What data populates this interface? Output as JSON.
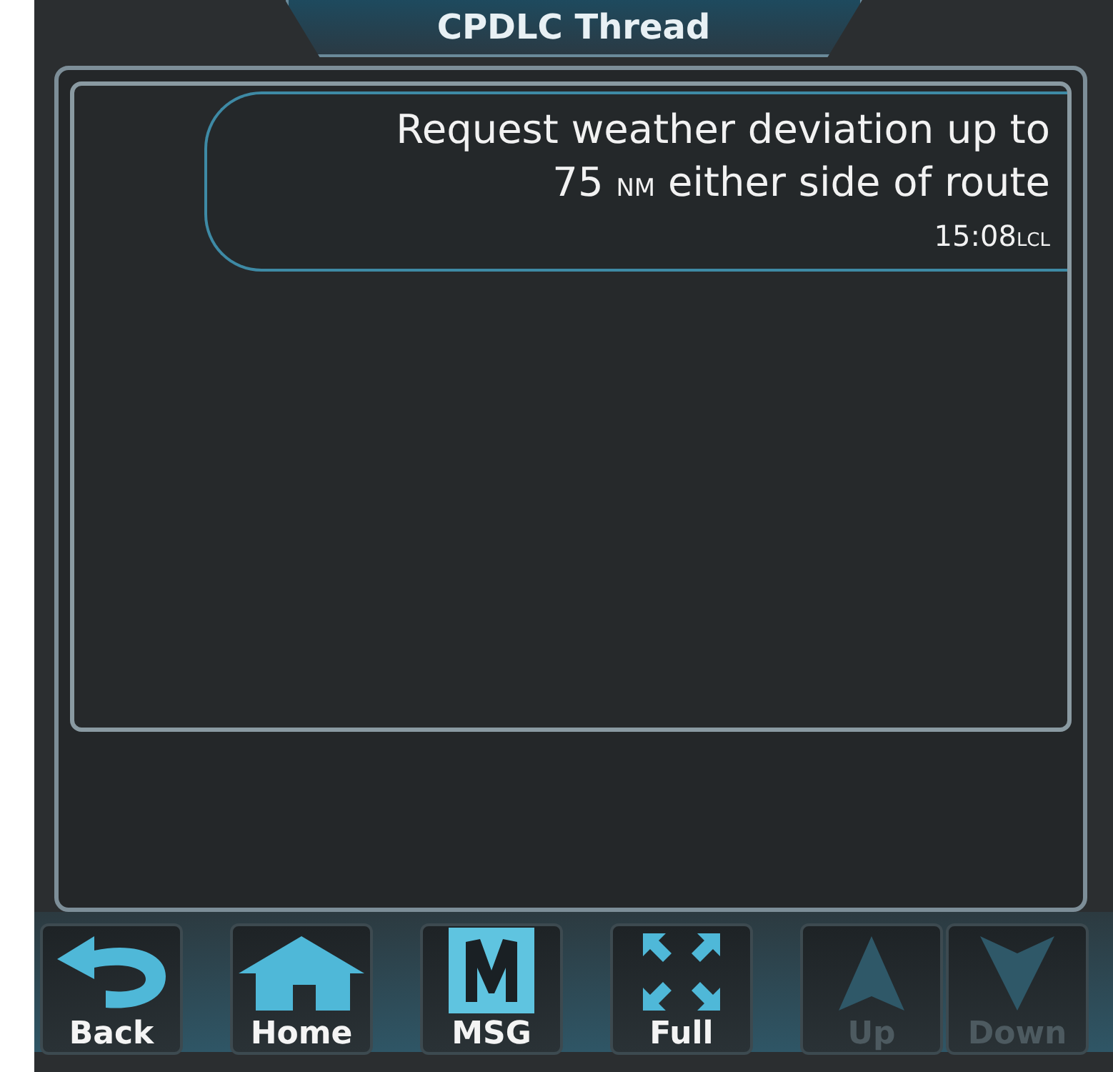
{
  "window": {
    "title": "CPDLC Thread"
  },
  "message": {
    "lines": [
      [
        {
          "text": "Request weather deviation up to",
          "kind": "plain"
        }
      ],
      [
        {
          "text": "75 ",
          "kind": "plain"
        },
        {
          "text": "NM",
          "kind": "unit"
        },
        {
          "text": " either side of route",
          "kind": "plain"
        }
      ]
    ],
    "time": "15:08",
    "time_unit": "LCL"
  },
  "buttons": [
    {
      "label": "Back",
      "kind": "back",
      "disabled": false
    },
    {
      "label": "Home",
      "kind": "home",
      "disabled": false
    },
    {
      "label": "MSG",
      "kind": "msg",
      "disabled": false
    },
    {
      "label": "Full",
      "kind": "full",
      "disabled": false
    },
    {
      "label": "Up",
      "kind": "up",
      "disabled": true
    },
    {
      "label": "Down",
      "kind": "down",
      "disabled": true
    }
  ]
}
